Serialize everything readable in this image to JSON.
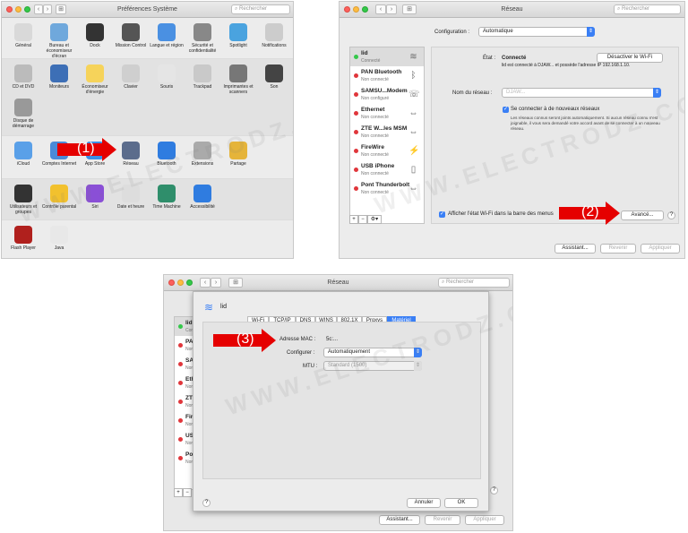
{
  "panel1": {
    "title": "Préférences Système",
    "search_placeholder": "Rechercher",
    "row1": [
      {
        "label": "Général",
        "color": "#d9d9d9",
        "icon": "general-icon"
      },
      {
        "label": "Bureau et économiseur d'écran",
        "color": "#6fa8dc",
        "icon": "desktop-icon"
      },
      {
        "label": "Dock",
        "color": "#333333",
        "icon": "dock-icon"
      },
      {
        "label": "Mission Control",
        "color": "#555555",
        "icon": "mission-control-icon"
      },
      {
        "label": "Langue et région",
        "color": "#4a90e2",
        "icon": "language-icon"
      },
      {
        "label": "Sécurité et confidentialité",
        "color": "#888888",
        "icon": "security-icon"
      },
      {
        "label": "Spotlight",
        "color": "#4aa3df",
        "icon": "spotlight-icon"
      },
      {
        "label": "Notifications",
        "color": "#cccccc",
        "icon": "notifications-icon"
      }
    ],
    "row2": [
      {
        "label": "CD et DVD",
        "color": "#bbbbbb",
        "icon": "cd-icon"
      },
      {
        "label": "Moniteurs",
        "color": "#3d6fb6",
        "icon": "displays-icon"
      },
      {
        "label": "Économiseur d'énergie",
        "color": "#f6d35a",
        "icon": "energy-icon"
      },
      {
        "label": "Clavier",
        "color": "#cfcfcf",
        "icon": "keyboard-icon"
      },
      {
        "label": "Souris",
        "color": "#e5e5e5",
        "icon": "mouse-icon"
      },
      {
        "label": "Trackpad",
        "color": "#c9c9c9",
        "icon": "trackpad-icon"
      },
      {
        "label": "Imprimantes et scanners",
        "color": "#777777",
        "icon": "printer-icon"
      },
      {
        "label": "Son",
        "color": "#444444",
        "icon": "sound-icon"
      }
    ],
    "row2b": [
      {
        "label": "Disque de démarrage",
        "color": "#999999",
        "icon": "startup-disk-icon"
      }
    ],
    "row3": [
      {
        "label": "iCloud",
        "color": "#5aa0e8",
        "icon": "icloud-icon"
      },
      {
        "label": "Comptes Internet",
        "color": "#4a8ad8",
        "icon": "internet-accounts-icon"
      },
      {
        "label": "App Store",
        "color": "#3a8ee6",
        "icon": "app-store-icon"
      },
      {
        "label": "Réseau",
        "color": "#5b6c8c",
        "icon": "network-icon"
      },
      {
        "label": "Bluetooth",
        "color": "#2f7ce0",
        "icon": "bluetooth-icon"
      },
      {
        "label": "Extensions",
        "color": "#aaaaaa",
        "icon": "extensions-icon"
      },
      {
        "label": "Partage",
        "color": "#e5b43a",
        "icon": "sharing-icon"
      }
    ],
    "row4": [
      {
        "label": "Utilisateurs et groupes",
        "color": "#333333",
        "icon": "users-icon"
      },
      {
        "label": "Contrôle parental",
        "color": "#f2c12e",
        "icon": "parental-icon"
      },
      {
        "label": "Siri",
        "color": "#8a4fd6",
        "icon": "siri-icon"
      },
      {
        "label": "Date et heure",
        "color": "#dddddd",
        "icon": "date-time-icon"
      },
      {
        "label": "Time Machine",
        "color": "#2f8e6b",
        "icon": "time-machine-icon"
      },
      {
        "label": "Accessibilité",
        "color": "#2f7ce0",
        "icon": "accessibility-icon"
      }
    ],
    "row5": [
      {
        "label": "Flash Player",
        "color": "#b0201d",
        "icon": "flash-icon"
      },
      {
        "label": "Java",
        "color": "#e8e8e8",
        "icon": "java-icon"
      }
    ],
    "arrow": "(1)"
  },
  "panel2": {
    "title": "Réseau",
    "search_placeholder": "Rechercher",
    "config_label": "Configuration :",
    "config_value": "Automatique",
    "services": [
      {
        "name": "lid",
        "status": "Connecté",
        "dot": "#34c84a",
        "icon": "wifi-icon",
        "glyph": "≋"
      },
      {
        "name": "PAN Bluetooth",
        "status": "Non connecté",
        "dot": "#e0363b",
        "icon": "bluetooth-icon",
        "glyph": "ᛒ"
      },
      {
        "name": "SAMSU...Modem",
        "status": "Non configuré",
        "dot": "#e0363b",
        "icon": "phone-icon",
        "glyph": "☏"
      },
      {
        "name": "Ethernet",
        "status": "Non connecté",
        "dot": "#e0363b",
        "icon": "ethernet-icon",
        "glyph": "⇔"
      },
      {
        "name": "ZTE W...les MSM",
        "status": "Non connecté",
        "dot": "#e0363b",
        "icon": "modem-icon",
        "glyph": "⇔"
      },
      {
        "name": "FireWire",
        "status": "Non connecté",
        "dot": "#e0363b",
        "icon": "firewire-icon",
        "glyph": "⚡"
      },
      {
        "name": "USB iPhone",
        "status": "Non connecté",
        "dot": "#e0363b",
        "icon": "iphone-icon",
        "glyph": "▯"
      },
      {
        "name": "Pont Thunderbolt",
        "status": "Non connecté",
        "dot": "#e0363b",
        "icon": "thunderbolt-icon",
        "glyph": "⇔"
      }
    ],
    "state_label": "État :",
    "state_value": "Connecté",
    "state_desc": "lid est connecté à DJAW... et possède l'adresse IP 192.168.1.10.",
    "disable_btn": "Désactiver le Wi-Fi",
    "network_name_label": "Nom du réseau :",
    "network_name_value": "DJAW...",
    "auto_join": "Se connecter à de nouveaux réseaux",
    "auto_join_desc": "Les réseaux connus seront joints automatiquement. Si aucun réseau connu n'est joignable, il vous sera demandé votre accord avant de se connecter à un nouveau réseau.",
    "show_status": "Afficher l'état Wi-Fi dans la barre des menus",
    "advanced_btn": "Avancé...",
    "help": "?",
    "assistant_btn": "Assistant...",
    "revert_btn": "Revenir",
    "apply_btn": "Appliquer",
    "arrow": "(2)"
  },
  "panel3": {
    "title": "Réseau",
    "search_placeholder": "Rechercher",
    "sheet_title": "lid",
    "tabs": [
      "Wi-Fi",
      "TCP/IP",
      "DNS",
      "WINS",
      "802.1X",
      "Proxys",
      "Matériel"
    ],
    "mac_label": "Adresse MAC :",
    "mac_value": "5c:...",
    "configure_label": "Configurer :",
    "configure_value": "Automatiquement",
    "mtu_label": "MTU :",
    "mtu_value": "Standard (1500)",
    "cancel_btn": "Annuler",
    "ok_btn": "OK",
    "help": "?",
    "assistant_btn": "Assistant...",
    "revert_btn": "Revenir",
    "apply_btn": "Appliquer",
    "bg_services": [
      {
        "name": "lid",
        "status": "Con",
        "dot": "#34c84a"
      },
      {
        "name": "PAN",
        "status": "Non",
        "dot": "#e0363b"
      },
      {
        "name": "SAM",
        "status": "Non",
        "dot": "#e0363b"
      },
      {
        "name": "Eth",
        "status": "Non",
        "dot": "#e0363b"
      },
      {
        "name": "ZTE",
        "status": "Non",
        "dot": "#e0363b"
      },
      {
        "name": "Fire",
        "status": "Non",
        "dot": "#e0363b"
      },
      {
        "name": "USB",
        "status": "Non",
        "dot": "#e0363b"
      },
      {
        "name": "Pon",
        "status": "Non",
        "dot": "#e0363b"
      }
    ],
    "arrow": "(3)"
  },
  "watermark": "WWW.ELECTRODZ.COM"
}
